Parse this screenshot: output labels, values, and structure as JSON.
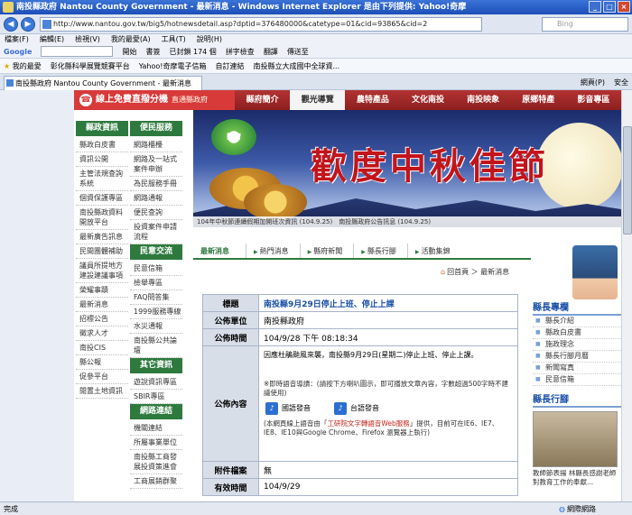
{
  "window": {
    "title": "南投縣政府 Nantou County Government - 最新消息 - Windows Internet Explorer 是由下列提供: Yahoo!奇摩"
  },
  "address_bar": {
    "url": "http://www.nantou.gov.tw/big5/hotnewsdetail.asp?dptid=376480000&catetype=01&cid=93865&cid=2",
    "search_placeholder": "Bing"
  },
  "menu": [
    "檔案(F)",
    "編輯(E)",
    "檢視(V)",
    "我的最愛(A)",
    "工具(T)",
    "說明(H)"
  ],
  "toolbar": {
    "google_label": "Google",
    "items": [
      "開始",
      "書簽",
      "已封鎖 174 個",
      "拼字檢查",
      "翻譯",
      "傳送至"
    ]
  },
  "favorites": {
    "label": "我的最愛",
    "items": [
      "彰化縣科學展覽競賽平台",
      "Yahoo!奇摩電子信箱",
      "自訂連結",
      "南投縣立大成國中全球資..."
    ]
  },
  "tabs": {
    "active_tab": "南投縣政府 Nantou County Government - 最新消息",
    "tools": [
      "網頁(P)",
      "安全"
    ]
  },
  "promo": {
    "label": "線上免費直撥分機",
    "sub": "直通縣政府"
  },
  "topnav": [
    "縣府簡介",
    "觀光導覽",
    "農特產品",
    "文化南投",
    "南投映象",
    "原鄉特產",
    "影音專區"
  ],
  "left_menu": {
    "head": "縣政資訊",
    "items": [
      "縣政白皮書",
      "資訊公開",
      "主管法規查詢系統",
      "個資保護專區",
      "南投縣政資料開放平台",
      "最新廣告訊息",
      "民間團體補助",
      "議員所提地方建設建議事項",
      "榮耀事蹟",
      "最新消息",
      "招標公告",
      "徵求人才",
      "南投CIS",
      "縣公報",
      "促參平台",
      "閒置土地資訊"
    ]
  },
  "mid_menu": [
    {
      "head": "便民服務",
      "items": [
        "網路櫃檯",
        "網路及一站式案件申辦",
        "為民服務手冊",
        "網路通報",
        "便民查詢",
        "投資案件申請流程"
      ]
    },
    {
      "head": "民意交流",
      "items": [
        "民意信箱",
        "檢舉專區",
        "FAQ問答集",
        "1999服務專線",
        "水災通報",
        "南投縣公共論壇"
      ]
    },
    {
      "head": "其它資訊",
      "items": [
        "遊說資訊專區",
        "SBIR專區"
      ]
    },
    {
      "head": "網路連結",
      "items": [
        "機關連結",
        "所屬事業單位",
        "南投縣工商發展投資策進會",
        "工商展銷群聚"
      ]
    }
  ],
  "banner": {
    "logo_text": "縣府",
    "headline": "歡度中秋佳節",
    "ticker": "104年中秋節連續假期加開班次資訊 (104.9.25)　南投縣政府公告訊息 (104.9.25)"
  },
  "news": {
    "title": "最新消息",
    "tabs": [
      "熱門消息",
      "縣府新聞",
      "縣長行腳",
      "活動集錦"
    ]
  },
  "breadcrumb": {
    "home": "回首頁",
    "current": "最新消息"
  },
  "detail": {
    "subject_label": "標題",
    "subject": "南投縣9月29日停止上班、停止上課",
    "unit_label": "公佈單位",
    "unit": "南投縣政府",
    "time_label": "公佈時間",
    "time": "104/9/28 下午 08:18:34",
    "content_label": "公佈內容",
    "content": "因應杜鵑颱風來襲，南投縣9月29日(星期二)停止上班、停止上課。",
    "voice_intro": "※即時語音導讀：(請按下方喇叭圖示，即可播放文章內容，字數超過500字時不建議使用)",
    "audio_mandarin": "國語發音",
    "audio_taiwanese": "台語發音",
    "note_prefix": "(本網頁線上語音由「",
    "note_link": "工研院文字轉語音Web服務",
    "note_suffix": "」提供，目前可在IE6、IE7、IE8、IE10與Google Chrome、Firefox 瀏覽器上執行)",
    "attach_label": "附件檔案",
    "attach": "無",
    "valid_label": "有效時間",
    "valid": "104/9/29"
  },
  "right_col": {
    "mayor_head": "縣長專欄",
    "mayor_links": [
      "縣長介紹",
      "縣政白皮書",
      "施政理念",
      "縣長行腳月曆",
      "新聞寫真",
      "民意信箱"
    ],
    "action_head": "縣長行腳",
    "caption": "教師節表揚 林縣長感謝老師對教育工作的奉獻..."
  },
  "status": {
    "left": "完成",
    "zone": "網際網路"
  }
}
